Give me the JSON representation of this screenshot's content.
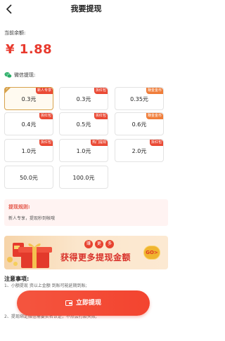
{
  "header": {
    "back_icon": "chevron-left-icon",
    "title": "我要提现"
  },
  "balance": {
    "label": "当前余额:",
    "value": "¥ 1.88"
  },
  "withdraw_section": {
    "label": "微信提现:",
    "icon": "wechat-icon"
  },
  "options": [
    {
      "amount": "0.3元",
      "tag": "新人专享",
      "selected": true
    },
    {
      "amount": "0.3元",
      "tag": "拆红包",
      "selected": false
    },
    {
      "amount": "0.35元",
      "tag": "赚金金币",
      "selected": false
    },
    {
      "amount": "0.4元",
      "tag": "拆红包",
      "selected": false
    },
    {
      "amount": "0.5元",
      "tag": "拆红包",
      "selected": false
    },
    {
      "amount": "0.6元",
      "tag": "赚金金币",
      "selected": false
    },
    {
      "amount": "1.0元",
      "tag": "拆红包",
      "selected": false
    },
    {
      "amount": "1.0元",
      "tag": "热门提现",
      "selected": false
    },
    {
      "amount": "2.0元",
      "tag": "拆红包",
      "selected": false
    },
    {
      "amount": "50.0元",
      "tag": "",
      "selected": false
    },
    {
      "amount": "100.0元",
      "tag": "",
      "selected": false
    }
  ],
  "rules": {
    "title": "提现规则:",
    "text": "新人专享，提现秒到帐哦"
  },
  "banner": {
    "chips": [
      "赚",
      "更",
      "多"
    ],
    "text": "获得更多提现金额",
    "button": "GO>"
  },
  "notice": {
    "title": "注意事项:",
    "item1": "1、小额提现                                                  资以上金额                                                  到账可能延期到账;",
    "item2": "2、提现绑定微信需要实名认证，不然会打款失败;"
  },
  "submit": {
    "label": "立即提现",
    "icon": "wallet-icon"
  },
  "colors": {
    "accent": "#e83a2e",
    "selected_border": "#d7a24c",
    "tag": "#ea4a35",
    "gold_tag": "#f07d39"
  }
}
